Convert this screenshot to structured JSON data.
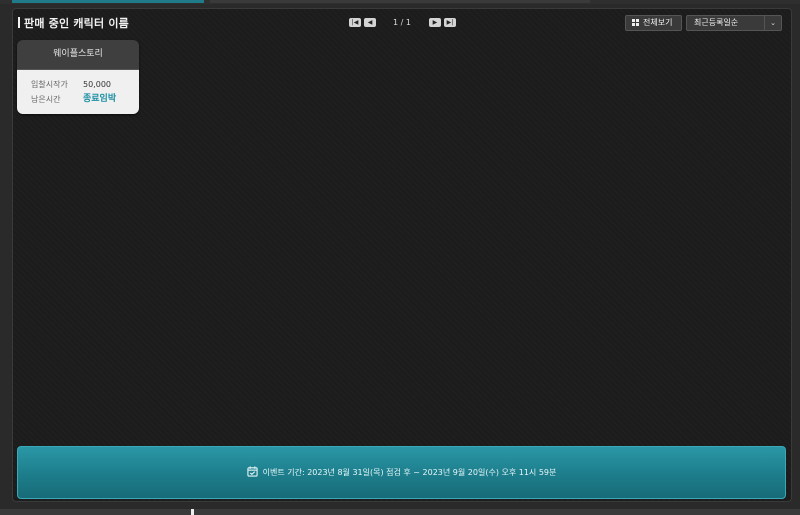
{
  "header": {
    "title": "판매 중인 캐릭터 이름"
  },
  "pager": {
    "first_icon": "first-page-icon",
    "prev_icon": "prev-page-icon",
    "next_icon": "next-page-icon",
    "last_icon": "last-page-icon",
    "count": "1 / 1"
  },
  "toolbar": {
    "view_all_label": "전체보기",
    "view_all_icon": "grid-icon",
    "sort_selected": "최근등록일순",
    "sort_icon": "chevron-down-icon"
  },
  "cards": [
    {
      "name": "웨이플스토리",
      "fields": [
        {
          "label": "입찰시작가",
          "value": "50,000"
        },
        {
          "label": "남은시간",
          "value": "종료임박"
        }
      ]
    }
  ],
  "banner": {
    "icon": "calendar-check-icon",
    "text": "이벤트 기간: 2023년 8월 31일(목) 점검 후 ~ 2023년 9월 20일(수) 오후 11시 59분"
  },
  "colors": {
    "accent": "#1c8fa3",
    "banner": "#1d7d8b",
    "panel_bg": "#1c1c1c"
  }
}
